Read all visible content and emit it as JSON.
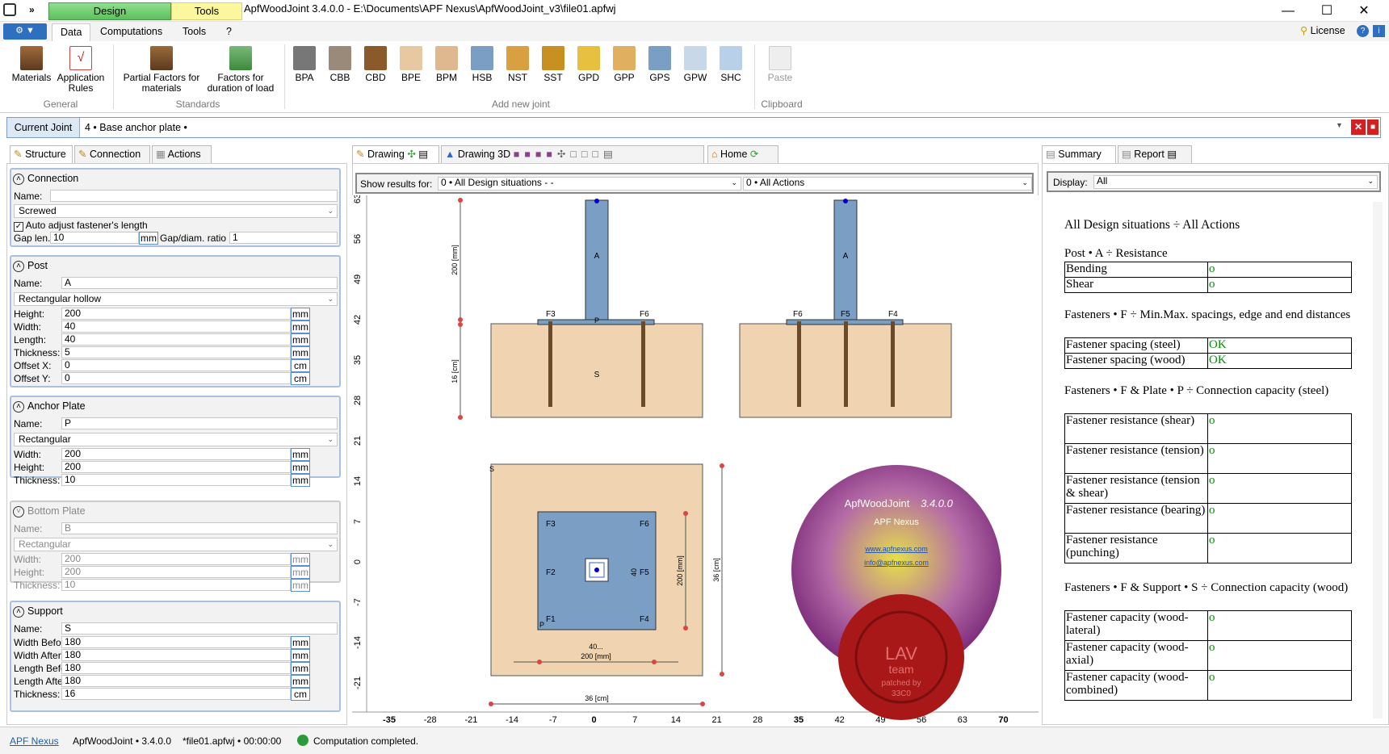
{
  "title": {
    "design": "Design",
    "tools": "Tools",
    "window": "ApfWoodJoint 3.4.0.0 - E:\\Documents\\APF Nexus\\ApfWoodJoint_v3\\file01.apfwj"
  },
  "ribbon_tabs": [
    "Data",
    "Computations",
    "Tools",
    "?"
  ],
  "license": "License",
  "ribbon": {
    "general": {
      "label": "General",
      "buttons": [
        "Materials",
        "Application Rules"
      ]
    },
    "standards": {
      "label": "Standards",
      "buttons": [
        "Partial Factors for materials",
        "Factors for duration of load"
      ]
    },
    "add_new_joint": {
      "label": "Add new joint",
      "buttons": [
        "BPA",
        "CBB",
        "CBD",
        "BPE",
        "BPM",
        "HSB",
        "NST",
        "SST",
        "GPD",
        "GPP",
        "GPS",
        "GPW",
        "SHC"
      ]
    },
    "clipboard": {
      "label": "Clipboard",
      "buttons": [
        "Paste"
      ]
    }
  },
  "joint": {
    "label": "Current Joint",
    "value": "4  •  Base anchor plate  •"
  },
  "left_tabs": [
    "Structure",
    "Connection",
    "Actions"
  ],
  "connection": {
    "title": "Connection",
    "name_label": "Name:",
    "name": "",
    "type": "Screwed",
    "auto_adjust": "Auto adjust fastener's length",
    "gap_len_label": "Gap len.",
    "gap_len": "10",
    "gap_unit": "mm",
    "gap_ratio_label": "Gap/diam. ratio",
    "gap_ratio": "1"
  },
  "post": {
    "title": "Post",
    "name_label": "Name:",
    "name": "A",
    "type": "Rectangular hollow",
    "rows": [
      {
        "label": "Height:",
        "value": "200",
        "unit": "mm"
      },
      {
        "label": "Width:",
        "value": "40",
        "unit": "mm"
      },
      {
        "label": "Length:",
        "value": "40",
        "unit": "mm"
      },
      {
        "label": "Thickness:",
        "value": "5",
        "unit": "mm"
      },
      {
        "label": "Offset X:",
        "value": "0",
        "unit": "cm"
      },
      {
        "label": "Offset Y:",
        "value": "0",
        "unit": "cm"
      }
    ]
  },
  "anchor_plate": {
    "title": "Anchor Plate",
    "name_label": "Name:",
    "name": "P",
    "type": "Rectangular",
    "rows": [
      {
        "label": "Width:",
        "value": "200",
        "unit": "mm"
      },
      {
        "label": "Height:",
        "value": "200",
        "unit": "mm"
      },
      {
        "label": "Thickness:",
        "value": "10",
        "unit": "mm"
      }
    ]
  },
  "bottom_plate": {
    "title": "Bottom Plate",
    "name_label": "Name:",
    "name": "B",
    "type": "Rectangular",
    "rows": [
      {
        "label": "Width:",
        "value": "200",
        "unit": "mm"
      },
      {
        "label": "Height:",
        "value": "200",
        "unit": "mm"
      },
      {
        "label": "Thickness:",
        "value": "10",
        "unit": "mm"
      }
    ]
  },
  "support": {
    "title": "Support",
    "name_label": "Name:",
    "name": "S",
    "rows": [
      {
        "label": "Width Before:",
        "value": "180",
        "unit": "mm"
      },
      {
        "label": "Width After:",
        "value": "180",
        "unit": "mm"
      },
      {
        "label": "Length Before:",
        "value": "180",
        "unit": "mm"
      },
      {
        "label": "Length After:",
        "value": "180",
        "unit": "mm"
      },
      {
        "label": "Thickness:",
        "value": "16",
        "unit": "cm"
      }
    ]
  },
  "mid_tabs": {
    "drawing": "Drawing",
    "drawing3d": "Drawing 3D",
    "home": "Home"
  },
  "show_results": {
    "label": "Show results for:",
    "situations": "0  •  All Design situations  -  -",
    "actions": "0  •  All Actions"
  },
  "drawing": {
    "left_ticks": [
      "63",
      "56",
      "49",
      "42",
      "35",
      "28",
      "21",
      "14",
      "7",
      "0",
      "-7",
      "-14",
      "-21"
    ],
    "bottom_ticks": [
      "-35",
      "-28",
      "-21",
      "-14",
      "-7",
      "0",
      "7",
      "14",
      "21",
      "28",
      "35",
      "42",
      "49",
      "56",
      "63",
      "70"
    ],
    "labels": {
      "A": "A",
      "P": "P",
      "S": "S",
      "F1": "F1",
      "F2": "F2",
      "F3": "F3",
      "F4": "F4",
      "F5": "F5",
      "F6": "F6"
    },
    "dims": {
      "post_h": "200 [mm]",
      "support_t": "16 [cm]",
      "plate_w": "200 [mm]",
      "plate_h": "200 [mm]",
      "support_w": "36 [cm]",
      "support_h": "36 [cm]",
      "post_w": "40",
      "post_l": "40..."
    }
  },
  "about": {
    "title": "ApfWoodJoint",
    "version": "3.4.0.0",
    "company": "APF Nexus",
    "web": "www.apfnexus.com",
    "email": "info@apfnexus.com",
    "seal1": "LAV",
    "seal2": "team",
    "seal3": "patched by",
    "seal4": "33C0"
  },
  "right_tabs": {
    "summary": "Summary",
    "report": "Report"
  },
  "display": {
    "label": "Display:",
    "value": "All"
  },
  "report": {
    "heading": "All Design situations ÷ All Actions",
    "sections": [
      {
        "title": "Post • A ÷ Resistance",
        "rows": [
          [
            "Bending",
            "o"
          ],
          [
            "Shear",
            "o"
          ]
        ]
      },
      {
        "title": "Fasteners • F ÷ Min.Max. spacings, edge and end distances",
        "rows": [
          [
            "Fastener spacing (steel)",
            "OK"
          ],
          [
            "Fastener spacing (wood)",
            "OK"
          ]
        ]
      },
      {
        "title": "Fasteners • F & Plate • P ÷ Connection capacity (steel)",
        "rows": [
          [
            "Fastener resistance (shear)",
            "o"
          ],
          [
            "Fastener resistance (tension)",
            "o"
          ],
          [
            "Fastener resistance (tension & shear)",
            "o"
          ],
          [
            "Fastener resistance (bearing)",
            "o"
          ],
          [
            "Fastener resistance (punching)",
            "o"
          ]
        ]
      },
      {
        "title": "Fasteners • F & Support • S ÷ Connection capacity (wood)",
        "rows": [
          [
            "Fastener capacity (wood-lateral)",
            "o"
          ],
          [
            "Fastener capacity (wood-axial)",
            "o"
          ],
          [
            "Fastener capacity (wood-combined)",
            "o"
          ]
        ]
      }
    ]
  },
  "status": {
    "link": "APF Nexus",
    "app": "ApfWoodJoint • 3.4.0.0",
    "file": "*file01.apfwj  •  00:00:00",
    "message": "Computation completed."
  },
  "colors": {
    "design_green": "#5cbf5c",
    "tools_yellow": "#fbf79e",
    "wood": "#f0d3b0",
    "steel": "#7a9ec4",
    "accent_blue": "#1a5fb4",
    "ok_green": "#0a8a0a"
  }
}
